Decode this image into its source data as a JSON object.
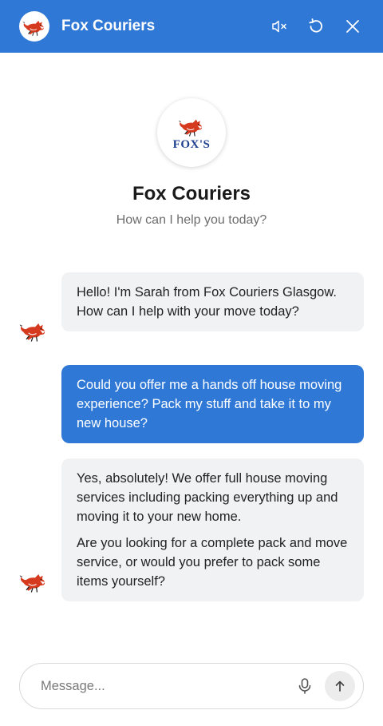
{
  "header": {
    "title": "Fox Couriers",
    "avatar_icon": "fox-logo-icon",
    "mute_icon": "speaker-mute-icon",
    "restart_icon": "restart-icon",
    "close_icon": "close-icon",
    "bg_color": "#2f78d6"
  },
  "intro": {
    "logo_text": "FOX'S",
    "title": "Fox Couriers",
    "subtitle": "How can I help you today?"
  },
  "messages": [
    {
      "role": "bot",
      "paragraphs": [
        "Hello! I'm Sarah from Fox Couriers Glasgow. How can I help with your move today?"
      ]
    },
    {
      "role": "user",
      "paragraphs": [
        "Could you offer me a hands off house moving experience? Pack my stuff and take it to my new house?"
      ]
    },
    {
      "role": "bot",
      "paragraphs": [
        "Yes, absolutely! We offer full house moving services including packing everything up and moving it to your new home.",
        "Are you looking for a complete pack and move service, or would you prefer to pack some items yourself?"
      ]
    }
  ],
  "composer": {
    "placeholder": "Message...",
    "value": "",
    "mic_icon": "microphone-icon",
    "send_icon": "send-arrow-icon"
  },
  "colors": {
    "accent": "#2f78d6",
    "bot_bubble": "#f1f2f3",
    "fox_red": "#d63a1e"
  }
}
